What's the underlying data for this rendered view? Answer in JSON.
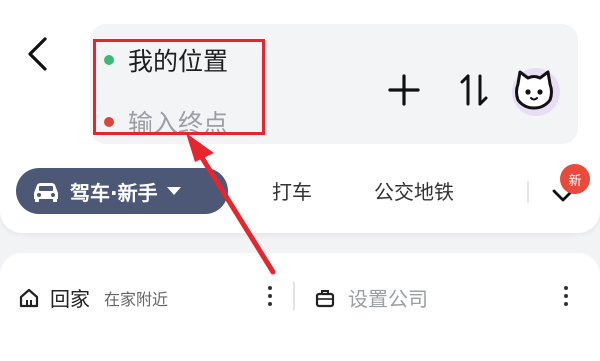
{
  "route": {
    "origin_label": "我的位置",
    "destination_placeholder": "输入终点",
    "origin_dot_color": "#3cb878",
    "destination_dot_color": "#d9463b"
  },
  "icons": {
    "back": "chevron-left-icon",
    "add": "plus-icon",
    "swap": "swap-vertical-icon",
    "avatar": "cat-avatar-icon",
    "car": "car-icon",
    "dropdown": "caret-down-icon",
    "more_modes": "chevron-down-icon",
    "home": "house-icon",
    "company": "briefcase-icon",
    "more": "vertical-dots-icon"
  },
  "modes": {
    "drive_label": "驾车·新手",
    "taxi_label": "打车",
    "transit_label": "公交地铁",
    "new_badge": "新"
  },
  "shortcuts": {
    "home_title": "回家",
    "home_subtitle": "在家附近",
    "company_placeholder": "设置公司"
  },
  "colors": {
    "accent_chip": "#4d5876",
    "annotation_red": "#e5262f",
    "badge_red": "#e84a3c"
  }
}
